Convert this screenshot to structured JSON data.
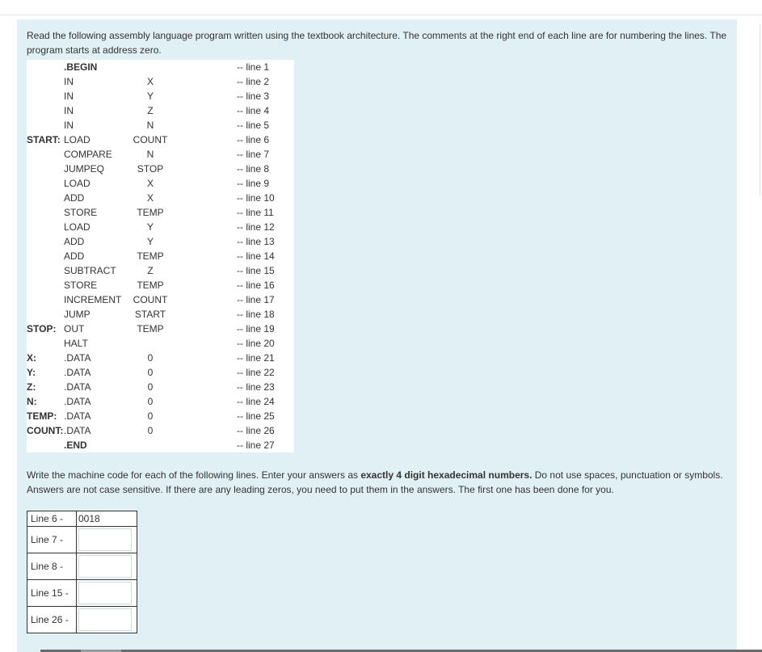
{
  "intro_text": "Read the following assembly language program written using the textbook architecture. The comments at the right end of each line are for numbering the lines. The program starts at address zero.",
  "program": [
    {
      "label": "",
      "op": ".BEGIN",
      "arg": "",
      "comment": "-- line 1",
      "op_bold": true
    },
    {
      "label": "",
      "op": "IN",
      "arg": "X",
      "comment": "-- line 2"
    },
    {
      "label": "",
      "op": "IN",
      "arg": "Y",
      "comment": "-- line 3"
    },
    {
      "label": "",
      "op": "IN",
      "arg": "Z",
      "comment": "-- line 4"
    },
    {
      "label": "",
      "op": "IN",
      "arg": "N",
      "comment": "-- line 5"
    },
    {
      "label": "START:",
      "op": "LOAD",
      "arg": "COUNT",
      "comment": "-- line 6"
    },
    {
      "label": "",
      "op": "COMPARE",
      "arg": "N",
      "comment": "-- line 7"
    },
    {
      "label": "",
      "op": "JUMPEQ",
      "arg": "STOP",
      "comment": "-- line 8"
    },
    {
      "label": "",
      "op": "LOAD",
      "arg": "X",
      "comment": "-- line 9"
    },
    {
      "label": "",
      "op": "ADD",
      "arg": "X",
      "comment": "-- line 10"
    },
    {
      "label": "",
      "op": "STORE",
      "arg": "TEMP",
      "comment": "-- line 11"
    },
    {
      "label": "",
      "op": "LOAD",
      "arg": "Y",
      "comment": "-- line 12"
    },
    {
      "label": "",
      "op": "ADD",
      "arg": "Y",
      "comment": "-- line 13"
    },
    {
      "label": "",
      "op": "ADD",
      "arg": "TEMP",
      "comment": "-- line 14"
    },
    {
      "label": "",
      "op": "SUBTRACT",
      "arg": "Z",
      "comment": "-- line 15"
    },
    {
      "label": "",
      "op": "STORE",
      "arg": "TEMP",
      "comment": "-- line 16"
    },
    {
      "label": "",
      "op": "INCREMENT",
      "arg": "COUNT",
      "comment": "-- line 17"
    },
    {
      "label": "",
      "op": " JUMP",
      "arg": "START",
      "comment": "-- line 18"
    },
    {
      "label": "STOP:",
      "op": "OUT",
      "arg": "TEMP",
      "comment": "-- line 19"
    },
    {
      "label": "",
      "op": "HALT",
      "arg": "",
      "comment": "-- line 20"
    },
    {
      "label": "X:",
      "op": ".DATA",
      "arg": "0",
      "comment": "-- line 21"
    },
    {
      "label": "Y:",
      "op": ".DATA",
      "arg": "0",
      "comment": "-- line 22"
    },
    {
      "label": "Z:",
      "op": ".DATA",
      "arg": "0",
      "comment": "-- line 23"
    },
    {
      "label": "N:",
      "op": ".DATA",
      "arg": "0",
      "comment": "-- line 24"
    },
    {
      "label": "TEMP:",
      "op": ".DATA",
      "arg": "0",
      "comment": "-- line 25"
    },
    {
      "label": "COUNT:",
      "op": ".DATA",
      "arg": "0",
      "comment": "-- line 26"
    },
    {
      "label": "",
      "op": ".END",
      "arg": "",
      "comment": "-- line 27",
      "op_bold": true
    }
  ],
  "instructions": {
    "part1": "Write the machine code for each of the following lines. Enter your answers as ",
    "bold": "exactly 4 digit hexadecimal numbers.",
    "part2": " Do not use spaces, punctuation or symbols. Answers are not case sensitive. If there are any leading zeros, you need to put them in the answers. The first one has been done for you."
  },
  "answers": [
    {
      "label": "Line 6 -",
      "value": "0018",
      "is_input": false
    },
    {
      "label": "Line 7 -",
      "value": "",
      "is_input": true
    },
    {
      "label": "Line 8 -",
      "value": "",
      "is_input": true
    },
    {
      "label": "Line 15 -",
      "value": "",
      "is_input": true
    },
    {
      "label": "Line 26 -",
      "value": "",
      "is_input": true
    }
  ],
  "colors": {
    "panel_bg": "#e1f0f5",
    "text": "#333333"
  }
}
